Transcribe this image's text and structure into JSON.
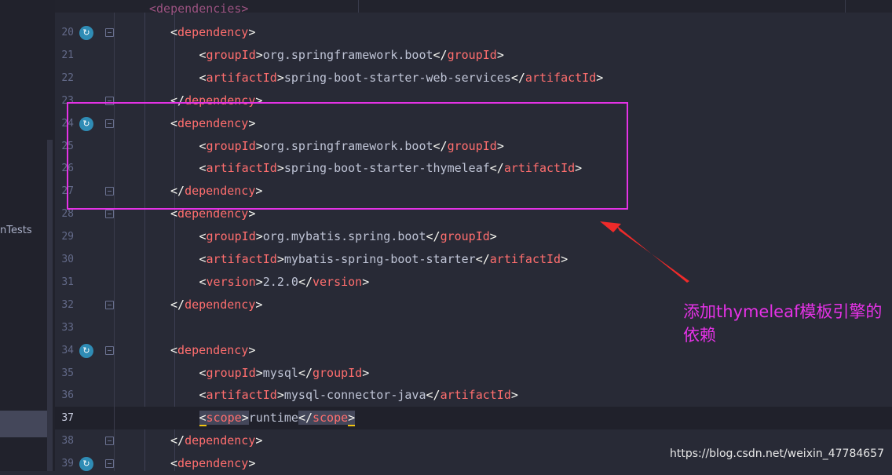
{
  "sidebar": {
    "partial_item": "nTests"
  },
  "top_partial_text": "<dependencies>",
  "lines": [
    {
      "n": "20",
      "indent": 1,
      "icon": true,
      "fold": true,
      "tokens": [
        [
          "p",
          "<"
        ],
        [
          "t",
          "dependency"
        ],
        [
          "p",
          ">"
        ]
      ]
    },
    {
      "n": "21",
      "indent": 2,
      "tokens": [
        [
          "p",
          "<"
        ],
        [
          "t",
          "groupId"
        ],
        [
          "p",
          ">"
        ],
        [
          "v",
          "org.springframework.boot"
        ],
        [
          "p",
          "</"
        ],
        [
          "t",
          "groupId"
        ],
        [
          "p",
          ">"
        ]
      ]
    },
    {
      "n": "22",
      "indent": 2,
      "tokens": [
        [
          "p",
          "<"
        ],
        [
          "t",
          "artifactId"
        ],
        [
          "p",
          ">"
        ],
        [
          "v",
          "spring-boot-starter-web-services"
        ],
        [
          "p",
          "</"
        ],
        [
          "t",
          "artifactId"
        ],
        [
          "p",
          ">"
        ]
      ]
    },
    {
      "n": "23",
      "indent": 1,
      "fold": true,
      "tokens": [
        [
          "p",
          "</"
        ],
        [
          "t",
          "dependency"
        ],
        [
          "p",
          ">"
        ]
      ]
    },
    {
      "n": "24",
      "indent": 1,
      "icon": true,
      "fold": true,
      "tokens": [
        [
          "p",
          "<"
        ],
        [
          "t",
          "dependency"
        ],
        [
          "p",
          ">"
        ]
      ]
    },
    {
      "n": "25",
      "indent": 2,
      "tokens": [
        [
          "p",
          "<"
        ],
        [
          "t",
          "groupId"
        ],
        [
          "p",
          ">"
        ],
        [
          "v",
          "org.springframework.boot"
        ],
        [
          "p",
          "</"
        ],
        [
          "t",
          "groupId"
        ],
        [
          "p",
          ">"
        ]
      ]
    },
    {
      "n": "26",
      "indent": 2,
      "tokens": [
        [
          "p",
          "<"
        ],
        [
          "t",
          "artifactId"
        ],
        [
          "p",
          ">"
        ],
        [
          "v",
          "spring-boot-starter-thymeleaf"
        ],
        [
          "p",
          "</"
        ],
        [
          "t",
          "artifactId"
        ],
        [
          "p",
          ">"
        ]
      ]
    },
    {
      "n": "27",
      "indent": 1,
      "fold": true,
      "tokens": [
        [
          "p",
          "</"
        ],
        [
          "t",
          "dependency"
        ],
        [
          "p",
          ">"
        ]
      ]
    },
    {
      "n": "28",
      "indent": 1,
      "fold": true,
      "tokens": [
        [
          "p",
          "<"
        ],
        [
          "t",
          "dependency"
        ],
        [
          "p",
          ">"
        ]
      ]
    },
    {
      "n": "29",
      "indent": 2,
      "tokens": [
        [
          "p",
          "<"
        ],
        [
          "t",
          "groupId"
        ],
        [
          "p",
          ">"
        ],
        [
          "v",
          "org.mybatis.spring.boot"
        ],
        [
          "p",
          "</"
        ],
        [
          "t",
          "groupId"
        ],
        [
          "p",
          ">"
        ]
      ]
    },
    {
      "n": "30",
      "indent": 2,
      "tokens": [
        [
          "p",
          "<"
        ],
        [
          "t",
          "artifactId"
        ],
        [
          "p",
          ">"
        ],
        [
          "v",
          "mybatis-spring-boot-starter"
        ],
        [
          "p",
          "</"
        ],
        [
          "t",
          "artifactId"
        ],
        [
          "p",
          ">"
        ]
      ]
    },
    {
      "n": "31",
      "indent": 2,
      "tokens": [
        [
          "p",
          "<"
        ],
        [
          "t",
          "version"
        ],
        [
          "p",
          ">"
        ],
        [
          "v",
          "2.2.0"
        ],
        [
          "p",
          "</"
        ],
        [
          "t",
          "version"
        ],
        [
          "p",
          ">"
        ]
      ]
    },
    {
      "n": "32",
      "indent": 1,
      "fold": true,
      "tokens": [
        [
          "p",
          "</"
        ],
        [
          "t",
          "dependency"
        ],
        [
          "p",
          ">"
        ]
      ]
    },
    {
      "n": "33",
      "indent": 0,
      "tokens": []
    },
    {
      "n": "34",
      "indent": 1,
      "icon": true,
      "fold": true,
      "tokens": [
        [
          "p",
          "<"
        ],
        [
          "t",
          "dependency"
        ],
        [
          "p",
          ">"
        ]
      ]
    },
    {
      "n": "35",
      "indent": 2,
      "tokens": [
        [
          "p",
          "<"
        ],
        [
          "t",
          "groupId"
        ],
        [
          "p",
          ">"
        ],
        [
          "v",
          "mysql"
        ],
        [
          "p",
          "</"
        ],
        [
          "t",
          "groupId"
        ],
        [
          "p",
          ">"
        ]
      ]
    },
    {
      "n": "36",
      "indent": 2,
      "tokens": [
        [
          "p",
          "<"
        ],
        [
          "t",
          "artifactId"
        ],
        [
          "p",
          ">"
        ],
        [
          "v",
          "mysql-connector-java"
        ],
        [
          "p",
          "</"
        ],
        [
          "t",
          "artifactId"
        ],
        [
          "p",
          ">"
        ]
      ]
    },
    {
      "n": "37",
      "indent": 2,
      "current": true,
      "tokens": [
        [
          "p hl ul",
          "<"
        ],
        [
          "t hl",
          "scope"
        ],
        [
          "p hl",
          ">"
        ],
        [
          "v",
          "runtime"
        ],
        [
          "p hl",
          "</"
        ],
        [
          "t hl",
          "scope"
        ],
        [
          "p hl ul",
          ">"
        ]
      ]
    },
    {
      "n": "38",
      "indent": 1,
      "fold": true,
      "tokens": [
        [
          "p",
          "</"
        ],
        [
          "t",
          "dependency"
        ],
        [
          "p",
          ">"
        ]
      ]
    },
    {
      "n": "39",
      "indent": 1,
      "icon": true,
      "fold": true,
      "tokens": [
        [
          "p",
          "<"
        ],
        [
          "t",
          "dependency"
        ],
        [
          "p",
          ">"
        ]
      ]
    }
  ],
  "icons": {
    "gutter": "run-icon",
    "fold": "fold-marker-icon"
  },
  "annotation": "添加thymeleaf模板引擎的依赖",
  "watermark": "https://blog.csdn.net/weixin_47784657",
  "colors": {
    "tag": "#ff6e6e",
    "annotation": "#e532e6",
    "background": "#282a36"
  }
}
